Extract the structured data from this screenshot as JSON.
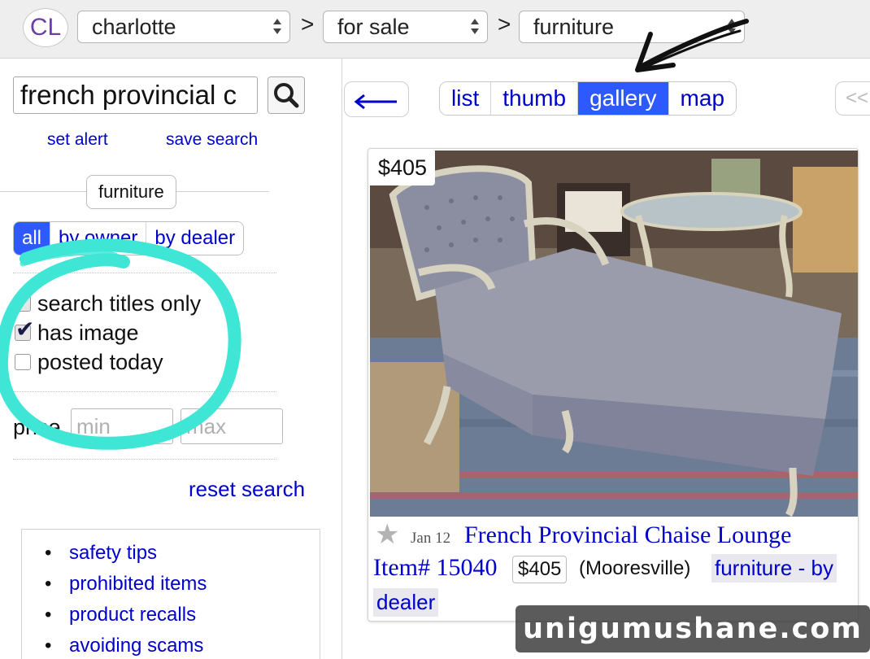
{
  "header": {
    "logo": "CL",
    "breadcrumb": [
      {
        "label": "charlotte"
      },
      {
        "label": "for sale"
      },
      {
        "label": "furniture"
      }
    ],
    "separator": ">"
  },
  "sidebar": {
    "search_value": "french provincial c",
    "set_alert": "set alert",
    "save_search": "save search",
    "category": "furniture",
    "seller_filter": [
      {
        "label": "all",
        "selected": true
      },
      {
        "label": "by owner",
        "selected": false
      },
      {
        "label": "by dealer",
        "selected": false
      }
    ],
    "checkboxes": [
      {
        "label": "search titles only",
        "checked": true
      },
      {
        "label": "has image",
        "checked": true
      },
      {
        "label": "posted today",
        "checked": false
      }
    ],
    "price_label": "price",
    "price_min_placeholder": "min",
    "price_max_placeholder": "max",
    "reset": "reset search",
    "tips": [
      "safety tips",
      "prohibited items",
      "product recalls",
      "avoiding scams"
    ]
  },
  "toolbar": {
    "back_glyph": "←",
    "views": [
      {
        "label": "list",
        "selected": false
      },
      {
        "label": "thumb",
        "selected": false
      },
      {
        "label": "gallery",
        "selected": true
      },
      {
        "label": "map",
        "selected": false
      }
    ],
    "pager_glyph": "<<"
  },
  "result": {
    "price": "$405",
    "date": "Jan 12",
    "title_line1": "French Provincial Chaise Lounge",
    "title_line2": "Item# 15040",
    "price_badge": "$405",
    "location": "(Mooresville)",
    "category_line1": "furniture - by",
    "category_line2": "dealer"
  },
  "watermark": "unigumushane.com",
  "colors": {
    "link": "#0000cc",
    "selected_tab": "#2e59ff",
    "annotation_circle": "#3fe6d6",
    "logo_purple": "#6a3ea8"
  }
}
